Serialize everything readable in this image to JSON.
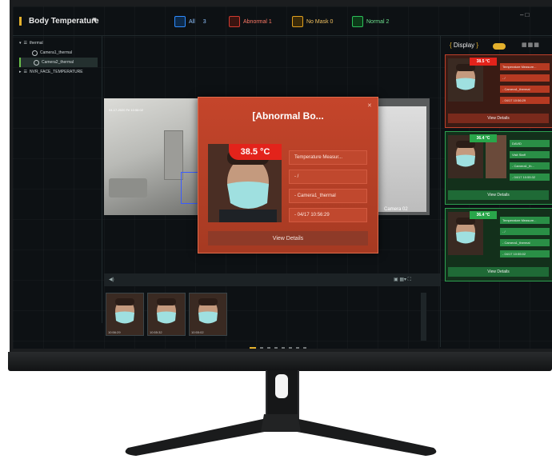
{
  "app": {
    "title": "Body Temperature"
  },
  "filters": [
    {
      "label": "All",
      "count": "3"
    },
    {
      "label": "Abnormal 1"
    },
    {
      "label": "No Mask 0"
    },
    {
      "label": "Normal 2"
    }
  ],
  "tree": {
    "root": "thermal",
    "children": [
      "Camera1_thermal",
      "Camera2_thermal"
    ],
    "second": "NVR_FACE_TEMPERATURE"
  },
  "video": {
    "timestamp": "04-17-2020 Fri 10:56:02",
    "camera_label": "Camera 02"
  },
  "popup": {
    "title": "[Abnormal Bo...",
    "temperature": "38.5 °C",
    "fields": [
      "Temperature Measur...",
      "- /",
      "- Camera1_thermal",
      "- 04/17 10:56:29"
    ],
    "button": "View Details"
  },
  "thumbs": [
    "10:56:29",
    "10:55:32",
    "10:55:02"
  ],
  "right_panel": {
    "display_label": "Display",
    "cards": [
      {
        "status": "abnormal",
        "temperature": "38.5 °C",
        "fields": [
          "Temperature Measure...",
          "- /",
          "- Camera1_thermal",
          "- 04/17 10:56:29"
        ],
        "button": "View Details"
      },
      {
        "status": "normal",
        "temperature": "36.4 °C",
        "fields": [
          "DAVID",
          "Visit Staff",
          "- Camera1_th...",
          "- 04/17 10:55:32"
        ],
        "button": "View Details"
      },
      {
        "status": "normal",
        "temperature": "36.4 °C",
        "fields": [
          "Temperature Measure...",
          "- /",
          "- Camera1_thermal",
          "- 04/17 10:55:02"
        ],
        "button": "View Details"
      }
    ]
  },
  "colors": {
    "accent": "#e3b02c",
    "abnormal": "#e3231b",
    "normal": "#29a64a"
  }
}
